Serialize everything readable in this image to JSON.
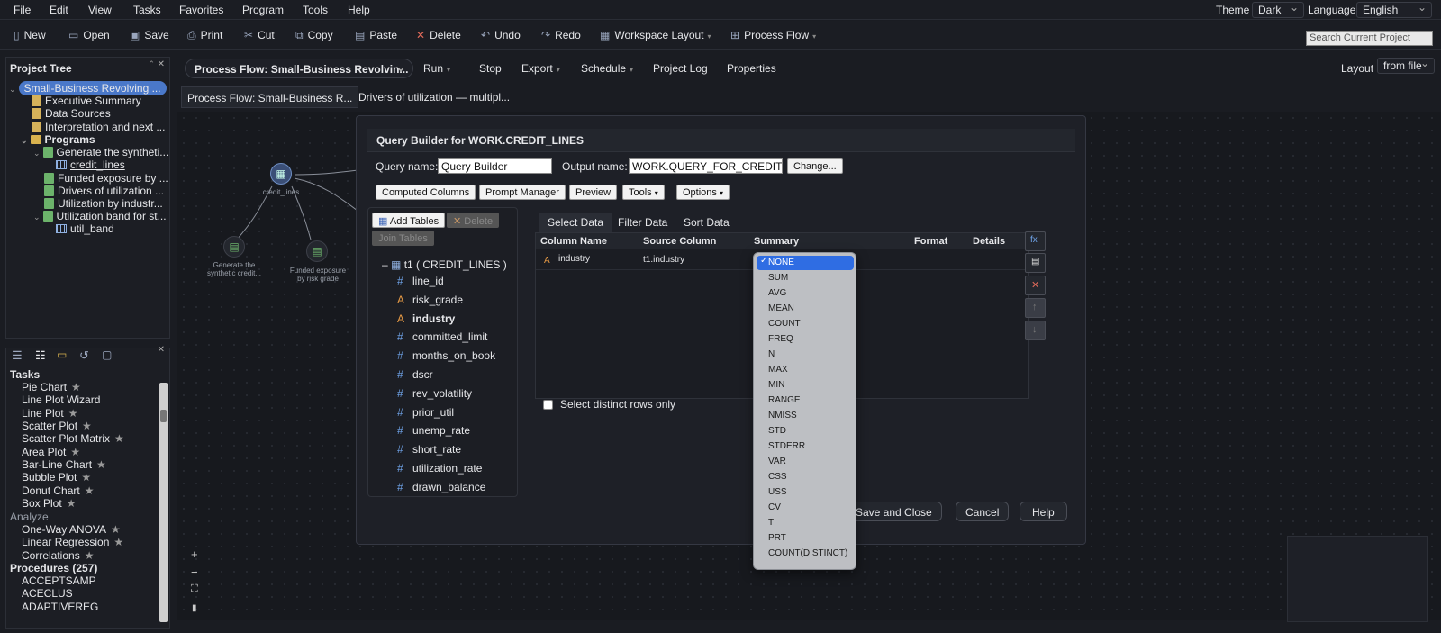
{
  "menubar": {
    "items": [
      "File",
      "Edit",
      "View",
      "Tasks",
      "Favorites",
      "Program",
      "Tools",
      "Help"
    ],
    "theme_label": "Theme",
    "theme_value": "Dark",
    "language_label": "Language",
    "language_value": "English"
  },
  "toolbar": {
    "new": "New",
    "open": "Open",
    "save": "Save",
    "print": "Print",
    "cut": "Cut",
    "copy": "Copy",
    "paste": "Paste",
    "delete": "Delete",
    "undo": "Undo",
    "redo": "Redo",
    "workspace_layout": "Workspace Layout",
    "process_flow": "Process Flow",
    "search_placeholder": "Search Current Project"
  },
  "project_tree": {
    "title": "Project Tree",
    "root": "Small-Business Revolving ...",
    "items": [
      "Executive Summary",
      "Data Sources",
      "Interpretation and next ...",
      "Programs",
      "Generate the syntheti...",
      "credit_lines",
      "Funded exposure by ...",
      "Drivers of utilization ...",
      "Utilization by industr...",
      "Utilization band for st...",
      "util_band"
    ]
  },
  "tasks": {
    "title": "Tasks",
    "items": [
      "Pie Chart",
      "Line Plot Wizard",
      "Line Plot",
      "Scatter Plot",
      "Scatter Plot Matrix",
      "Area Plot",
      "Bar-Line Chart",
      "Bubble Plot",
      "Donut Chart",
      "Box Plot"
    ],
    "analyze_header": "Analyze",
    "analyze_items": [
      "One-Way ANOVA",
      "Linear Regression",
      "Correlations"
    ],
    "procedures_header": "Procedures (257)",
    "procedures": [
      "ACCEPTSAMP",
      "ACECLUS",
      "ADAPTIVEREG"
    ]
  },
  "editor": {
    "flow_select": "Process Flow: Small-Business Revolvin...",
    "run": "Run",
    "stop": "Stop",
    "export": "Export",
    "schedule": "Schedule",
    "project_log": "Project Log",
    "properties": "Properties",
    "layout_label": "Layout",
    "layout_value": "from file"
  },
  "tabs": [
    "Process Flow: Small-Business R...",
    "Drivers of utilization — multipl..."
  ],
  "flow_nodes": {
    "credit_lines": "credit_lines",
    "generate": "Generate the synthetic credit...",
    "funded": "Funded exposure by risk grade"
  },
  "dialog": {
    "title": "Query Builder for WORK.CREDIT_LINES",
    "query_name_label": "Query name:",
    "query_name_value": "Query Builder",
    "output_name_label": "Output name:",
    "output_name_value": "WORK.QUERY_FOR_CREDIT_LIN",
    "change_button": "Change...",
    "computed_columns": "Computed Columns",
    "prompt_manager": "Prompt Manager",
    "preview": "Preview",
    "tools": "Tools",
    "options": "Options",
    "add_tables": "Add Tables",
    "delete": "Delete",
    "join_tables": "Join Tables",
    "table_name": "t1 ( CREDIT_LINES )",
    "columns": [
      {
        "type": "#",
        "name": "line_id"
      },
      {
        "type": "A",
        "name": "risk_grade"
      },
      {
        "type": "A",
        "name": "industry"
      },
      {
        "type": "#",
        "name": "committed_limit"
      },
      {
        "type": "#",
        "name": "months_on_book"
      },
      {
        "type": "#",
        "name": "dscr"
      },
      {
        "type": "#",
        "name": "rev_volatility"
      },
      {
        "type": "#",
        "name": "prior_util"
      },
      {
        "type": "#",
        "name": "unemp_rate"
      },
      {
        "type": "#",
        "name": "short_rate"
      },
      {
        "type": "#",
        "name": "utilization_rate"
      },
      {
        "type": "#",
        "name": "drawn_balance"
      }
    ],
    "right_tabs": [
      "Select Data",
      "Filter Data",
      "Sort Data"
    ],
    "grid_headers": [
      "Column Name",
      "Source Column",
      "Summary",
      "Format",
      "Details"
    ],
    "row": {
      "type": "A",
      "name": "industry",
      "source": "t1.industry"
    },
    "distinct_label": "Select distinct rows only",
    "save_close": "Save and Close",
    "cancel": "Cancel",
    "help": "Help"
  },
  "summary_options": [
    "NONE",
    "SUM",
    "AVG",
    "MEAN",
    "COUNT",
    "FREQ",
    "N",
    "MAX",
    "MIN",
    "RANGE",
    "NMISS",
    "STD",
    "STDERR",
    "VAR",
    "CSS",
    "USS",
    "CV",
    "T",
    "PRT",
    "COUNT(DISTINCT)"
  ],
  "summary_selected": "NONE",
  "colors": {
    "accent": "#2f6de3",
    "background": "#1a1c22",
    "tree_selected": "#4a78c9"
  }
}
